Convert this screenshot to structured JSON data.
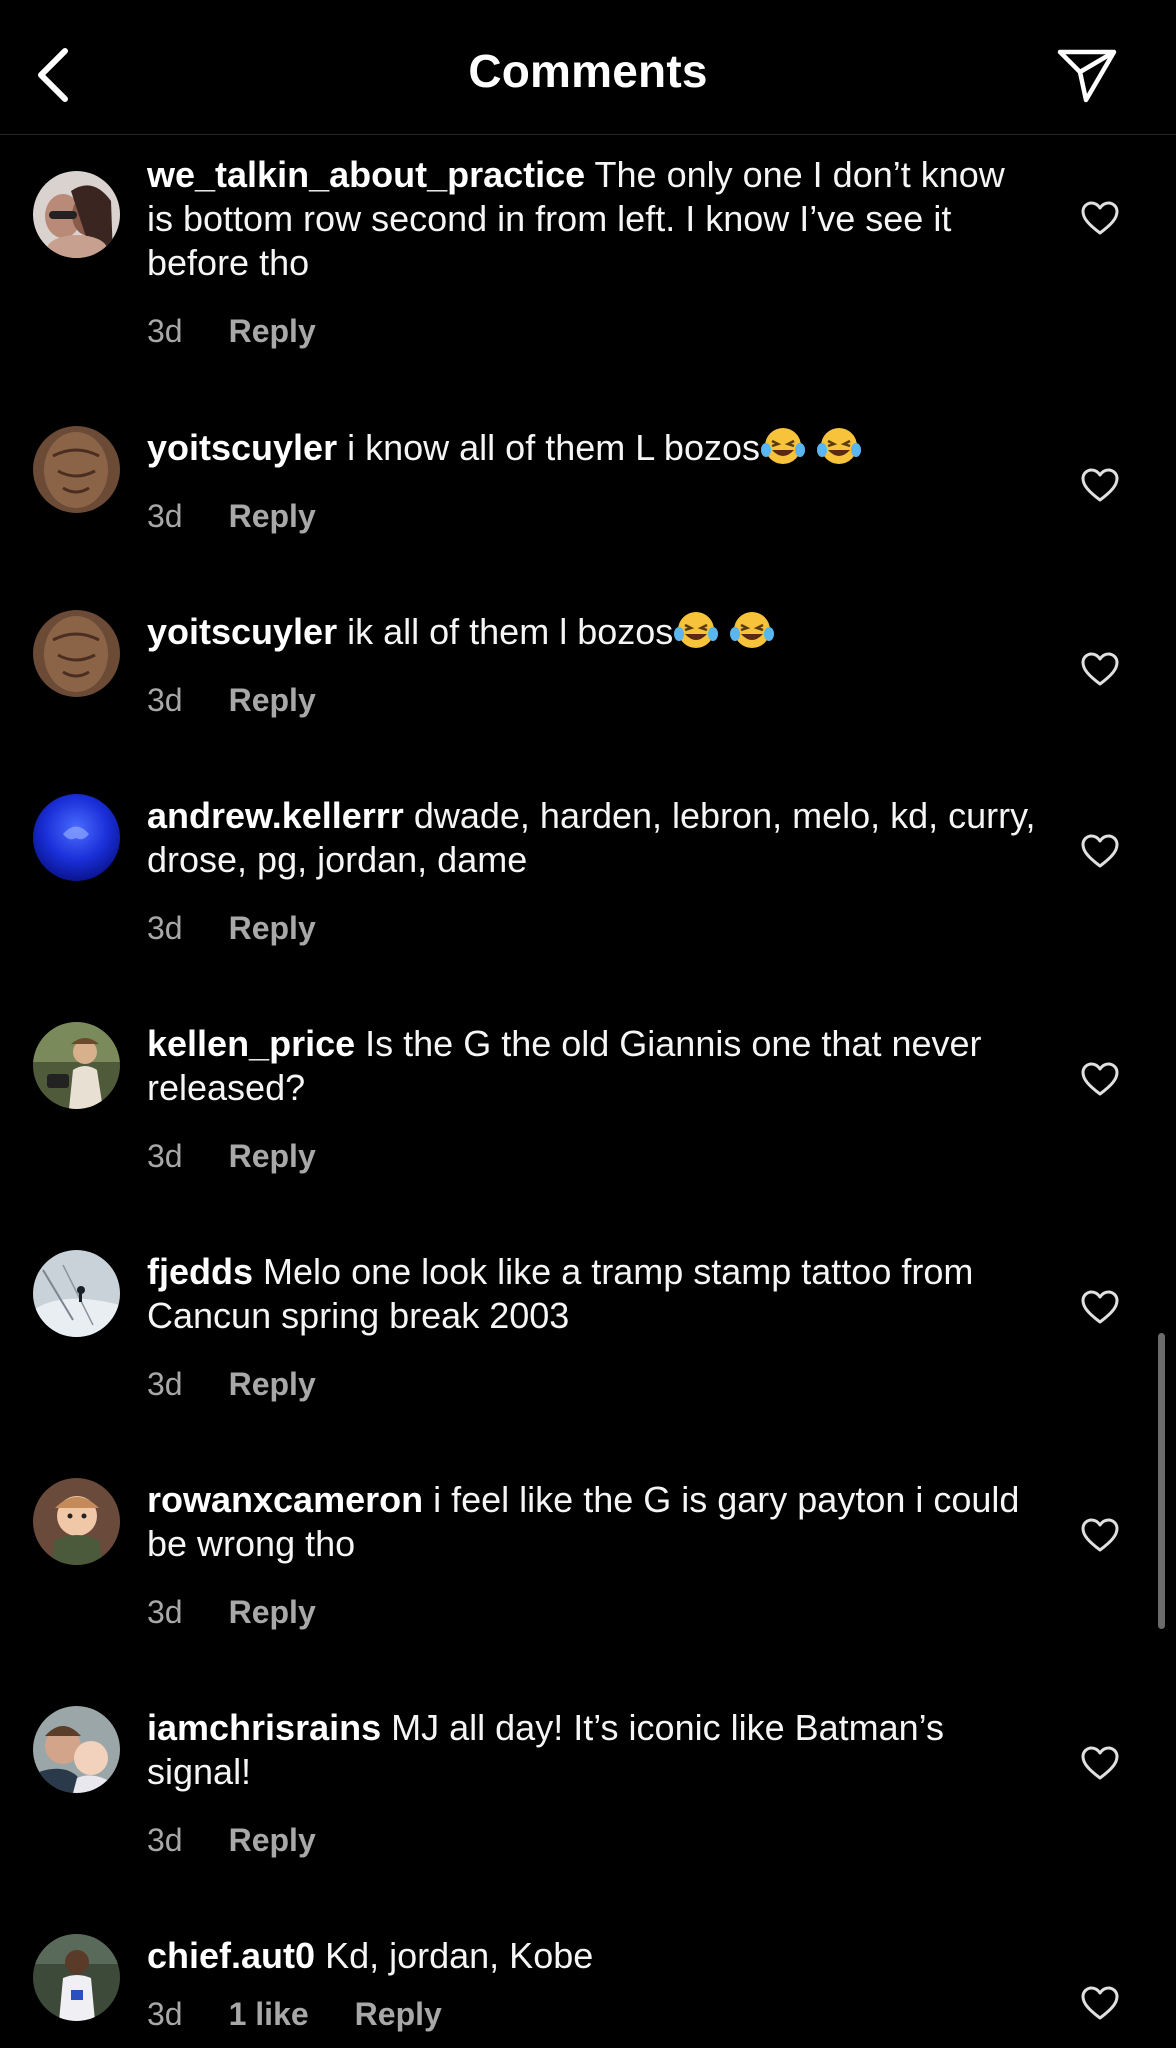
{
  "header": {
    "title": "Comments",
    "back_icon": "chevron-left-icon",
    "send_icon": "paper-plane-icon"
  },
  "comments": [
    {
      "username": "we_talkin_about_practice",
      "text": "The only one I don’t know is bottom row second in from left. I know I’ve see it before tho",
      "time": "3d",
      "reply": "Reply"
    },
    {
      "username": "yoitscuyler",
      "text": "i know all of them L bozos",
      "emoji": [
        "face-with-tears-of-joy",
        "face-with-tears-of-joy"
      ],
      "time": "3d",
      "reply": "Reply"
    },
    {
      "username": "yoitscuyler",
      "text": "ik all of them l bozos",
      "emoji": [
        "face-with-tears-of-joy",
        "face-with-tears-of-joy"
      ],
      "time": "3d",
      "reply": "Reply"
    },
    {
      "username": "andrew.kellerrr",
      "text": "dwade, harden, lebron, melo, kd, curry, drose, pg, jordan, dame",
      "time": "3d",
      "reply": "Reply"
    },
    {
      "username": "kellen_price",
      "text": "Is the G the old Giannis one that never released?",
      "time": "3d",
      "reply": "Reply"
    },
    {
      "username": "fjedds",
      "text": "Melo one look like a tramp stamp tattoo from Cancun spring break 2003",
      "time": "3d",
      "reply": "Reply"
    },
    {
      "username": "rowanxcameron",
      "text": "i feel like the G is gary payton i could be wrong tho",
      "time": "3d",
      "reply": "Reply"
    },
    {
      "username": "iamchrisrains",
      "text": "MJ all day! It’s iconic like Batman’s signal!",
      "time": "3d",
      "reply": "Reply"
    },
    {
      "username": "chief.aut0",
      "text": "Kd, jordan, Kobe",
      "time": "3d",
      "likes": "1 like",
      "reply": "Reply"
    }
  ],
  "colors": {
    "background": "#000000",
    "text": "#f5f5f5",
    "secondary": "#a8a8a8",
    "divider": "#262626"
  }
}
